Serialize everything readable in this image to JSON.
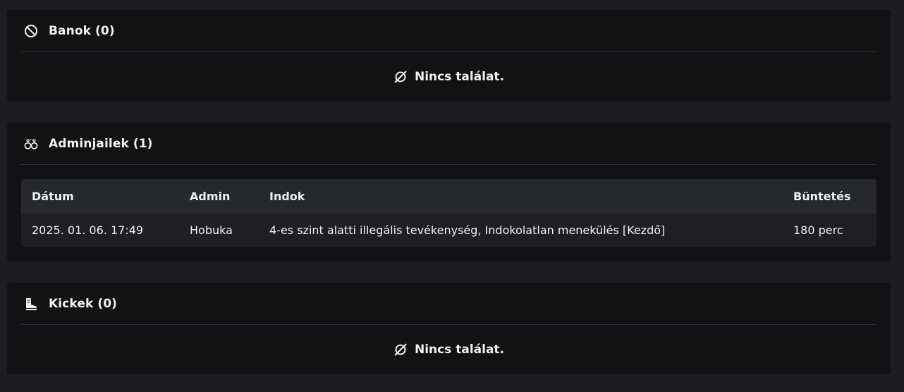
{
  "bans": {
    "title": "Banok (0)",
    "icon": "ban-icon",
    "empty_text": "Nincs találat."
  },
  "adminjails": {
    "title": "Adminjailek (1)",
    "icon": "handcuffs-icon",
    "columns": [
      "Dátum",
      "Admin",
      "Indok",
      "Büntetés"
    ],
    "rows": [
      [
        "2025. 01. 06. 17:49",
        "Hobuka",
        "4-es szint alatti illegális tevékenység, Indokolatlan menekülés [Kezdő]",
        "180 perc"
      ]
    ]
  },
  "kicks": {
    "title": "Kickek (0)",
    "icon": "boot-icon",
    "empty_text": "Nincs találat."
  },
  "empty_icon": "empty-set-icon"
}
